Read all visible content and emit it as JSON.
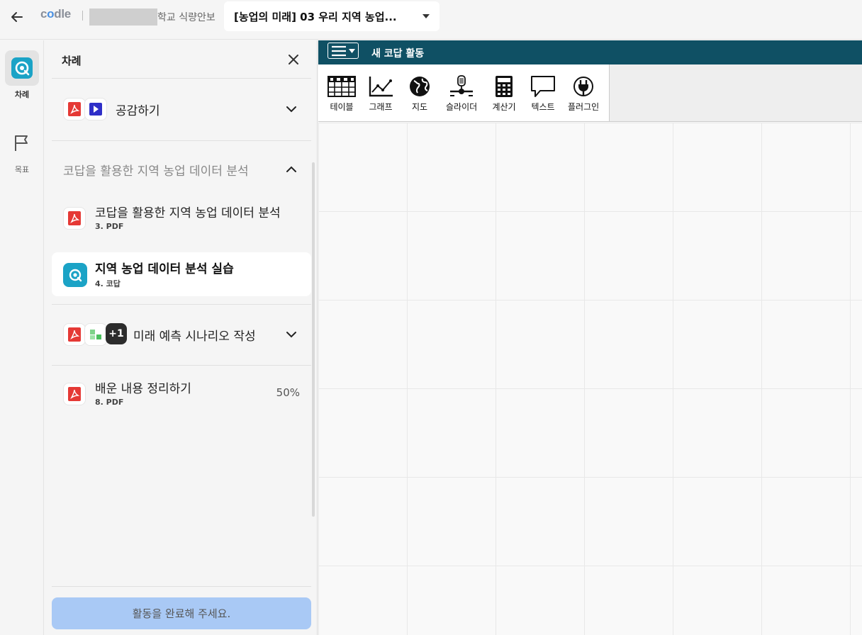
{
  "topbar": {
    "logo_prefix": "c",
    "logo_o": "o",
    "logo_suffix": "dle",
    "school_suffix": "학교 식량안보",
    "lesson_title": "[농업의 미래] 03 우리 지역 농업..."
  },
  "rail": {
    "toc_label": "차례",
    "goal_label": "목표"
  },
  "panel": {
    "title": "차례",
    "sections": [
      {
        "label": "공감하기",
        "expanded": false
      },
      {
        "label": "코답을 활용한 지역 농업 데이터 분석",
        "expanded": true
      },
      {
        "label": "미래 예측 시나리오 작성",
        "expanded": false,
        "extra_count": "+1"
      }
    ],
    "items": [
      {
        "name": "코답을 활용한 지역 농업 데이터 분석",
        "sub": "3. PDF"
      },
      {
        "name": "지역 농업 데이터 분석 실습",
        "sub": "4. 코답",
        "active": true
      },
      {
        "name": "배운 내용 정리하기",
        "sub": "8. PDF",
        "progress": "50%"
      }
    ],
    "complete_button": "활동을 완료해 주세요."
  },
  "codap": {
    "document_title": "새 코답 활동",
    "tools": [
      {
        "label": "테이블",
        "icon": "table-icon"
      },
      {
        "label": "그래프",
        "icon": "graph-icon"
      },
      {
        "label": "지도",
        "icon": "map-icon"
      },
      {
        "label": "슬라이더",
        "icon": "slider-icon"
      },
      {
        "label": "계산기",
        "icon": "calculator-icon"
      },
      {
        "label": "텍스트",
        "icon": "text-icon"
      },
      {
        "label": "플러그인",
        "icon": "plugin-icon"
      }
    ]
  },
  "colors": {
    "codap_header": "#0f5064",
    "codap_brand": "#1ba3c6",
    "complete_button": "#a9c9f5",
    "pdf_red": "#e53935",
    "video_blue": "#2f2fc8"
  }
}
